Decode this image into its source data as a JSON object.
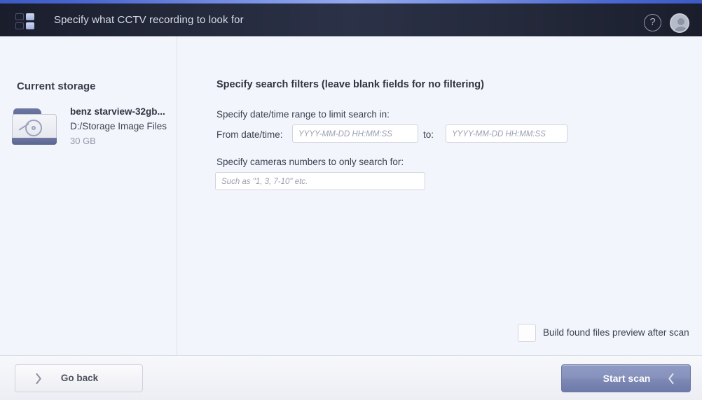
{
  "header": {
    "title": "Specify what CCTV recording to look for",
    "logo_icon": "app-grid-logo",
    "help_icon": "question-mark-icon",
    "help_label": "?",
    "avatar_icon": "user-avatar-icon"
  },
  "sidebar": {
    "title": "Current storage",
    "storage": {
      "icon": "folder-disk-icon",
      "name": "benz starview-32gb...",
      "path": "D:/Storage Image Files",
      "size": "30 GB"
    }
  },
  "main": {
    "section_title": "Specify search filters (leave blank fields for no filtering)",
    "daterange_label": "Specify date/time range to limit search in:",
    "from_label": "From date/time:",
    "to_label": "to:",
    "from_value": "",
    "from_placeholder": "YYYY-MM-DD HH:MM:SS",
    "to_value": "",
    "to_placeholder": "YYYY-MM-DD HH:MM:SS",
    "cameras_label": "Specify cameras numbers to only search for:",
    "cameras_value": "",
    "cameras_placeholder": "Such as \"1, 3, 7-10\" etc.",
    "preview_checkbox_label": "Build found files preview after scan",
    "preview_checkbox_checked": false
  },
  "footer": {
    "back_label": "Go back",
    "back_icon": "chevron-left-icon",
    "scan_label": "Start scan",
    "scan_icon": "chevron-right-icon"
  },
  "colors": {
    "accent_blue": "#7f97e8",
    "header_navy": "#2b3147",
    "page_background": "#f2f5fc",
    "primary_button": "#8893bd",
    "text_dark": "#2f3440",
    "text_muted": "#9298a6"
  }
}
